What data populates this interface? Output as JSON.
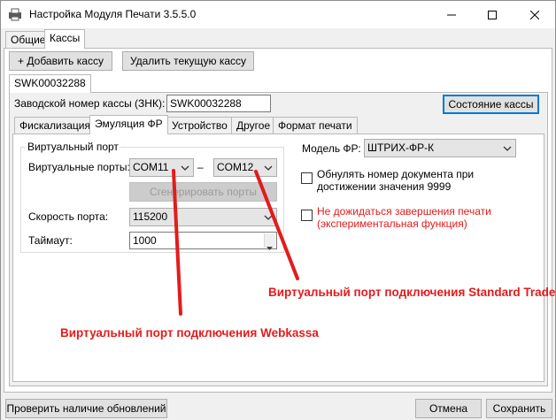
{
  "window": {
    "title": "Настройка Модуля Печати 3.5.5.0",
    "minimize_icon": "minimize-icon",
    "maximize_icon": "maximize-icon",
    "close_icon": "close-icon"
  },
  "tabs": [
    {
      "label": "Общие"
    },
    {
      "label": "Кассы"
    }
  ],
  "toolbar": {
    "add_label": "+ Добавить кассу",
    "delete_label": "Удалить текущую кассу"
  },
  "register_tab": {
    "label": "SWK00032288"
  },
  "serial": {
    "label": "Заводской номер кассы (ЗНК):",
    "value": "SWK00032288",
    "status_button": "Состояние кассы"
  },
  "inner_tabs": [
    {
      "label": "Фискализация"
    },
    {
      "label": "Эмуляция ФР"
    },
    {
      "label": "Устройство"
    },
    {
      "label": "Другое"
    },
    {
      "label": "Формат печати"
    }
  ],
  "virtual_port": {
    "group_title": "Виртуальный порт",
    "ports_label": "Виртуальные порты:",
    "port1": "COM11",
    "dash": "–",
    "port2": "COM12",
    "generate_button": "Сгенерировать порты",
    "speed_label": "Скорость порта:",
    "speed_value": "115200",
    "timeout_label": "Таймаут:",
    "timeout_value": "1000"
  },
  "model": {
    "label": "Модель ФР:",
    "value": "ШТРИХ-ФР-К"
  },
  "options": [
    {
      "line1": "Обнулять номер документа при",
      "line2": "достижении значения 9999",
      "checked": false
    },
    {
      "line1": "Не дожидаться завершения печати",
      "line2": "(экспериментальная функция)",
      "checked": false
    }
  ],
  "annotations": {
    "standard_trade": "Виртуальный порт подключения Standard Trade",
    "webkassa": "Виртуальный порт подключения Webkassa"
  },
  "footer": {
    "updates_button": "Проверить наличие обновлений",
    "cancel_button": "Отмена",
    "save_button": "Сохранить"
  },
  "colors": {
    "accent": "#0078d7",
    "annotation_red": "#e41b1b"
  }
}
